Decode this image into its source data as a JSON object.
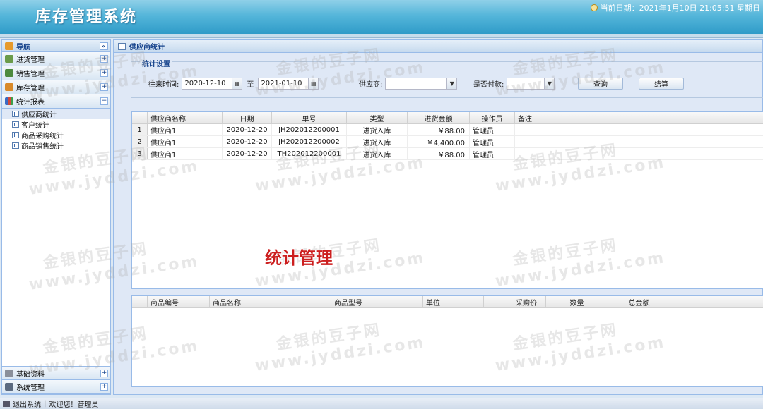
{
  "header": {
    "title": "库存管理系统",
    "date_text": "当前日期：2021年1月10日 21:05:51 星期日"
  },
  "sidebar": {
    "title": "导航",
    "sections_top": [
      {
        "label": "进货管理"
      },
      {
        "label": "销售管理"
      },
      {
        "label": "库存管理"
      },
      {
        "label": "统计报表"
      }
    ],
    "tree_items": [
      {
        "label": "供应商统计"
      },
      {
        "label": "客户统计"
      },
      {
        "label": "商品采购统计"
      },
      {
        "label": "商品销售统计"
      }
    ],
    "sections_bottom": [
      {
        "label": "基础资料"
      },
      {
        "label": "系统管理"
      }
    ]
  },
  "main": {
    "panel_title": "供应商统计",
    "settings_legend": "统计设置",
    "filters": {
      "time_label": "往来时间:",
      "from_date": "2020-12-10",
      "to_label": "至",
      "to_date": "2021-01-10",
      "supplier_label": "供应商:",
      "supplier_value": "",
      "paid_label": "是否付款:",
      "paid_value": "",
      "query_btn": "查询",
      "settle_btn": "结算"
    },
    "top_grid": {
      "columns": [
        "供应商名称",
        "日期",
        "单号",
        "类型",
        "进货金额",
        "操作员",
        "备注"
      ],
      "rows": [
        {
          "rn": "1",
          "supplier": "供应商1",
          "date": "2020-12-20",
          "no": "JH202012200001",
          "type": "进货入库",
          "amount": "￥88.00",
          "operator": "管理员",
          "note": ""
        },
        {
          "rn": "2",
          "supplier": "供应商1",
          "date": "2020-12-20",
          "no": "JH202012200002",
          "type": "进货入库",
          "amount": "￥4,400.00",
          "operator": "管理员",
          "note": ""
        },
        {
          "rn": "3",
          "supplier": "供应商1",
          "date": "2020-12-20",
          "no": "TH202012200001",
          "type": "进货入库",
          "amount": "￥88.00",
          "operator": "管理员",
          "note": ""
        }
      ]
    },
    "bottom_grid": {
      "columns": [
        "商品编号",
        "商品名称",
        "商品型号",
        "单位",
        "采购价",
        "数量",
        "总金额"
      ]
    },
    "overlay_text": "统计管理"
  },
  "watermark": {
    "line1": "金银的豆子网",
    "line2": "www.jyddzi.com"
  },
  "status": {
    "exit": "退出系统",
    "welcome": "欢迎您！管理员"
  }
}
